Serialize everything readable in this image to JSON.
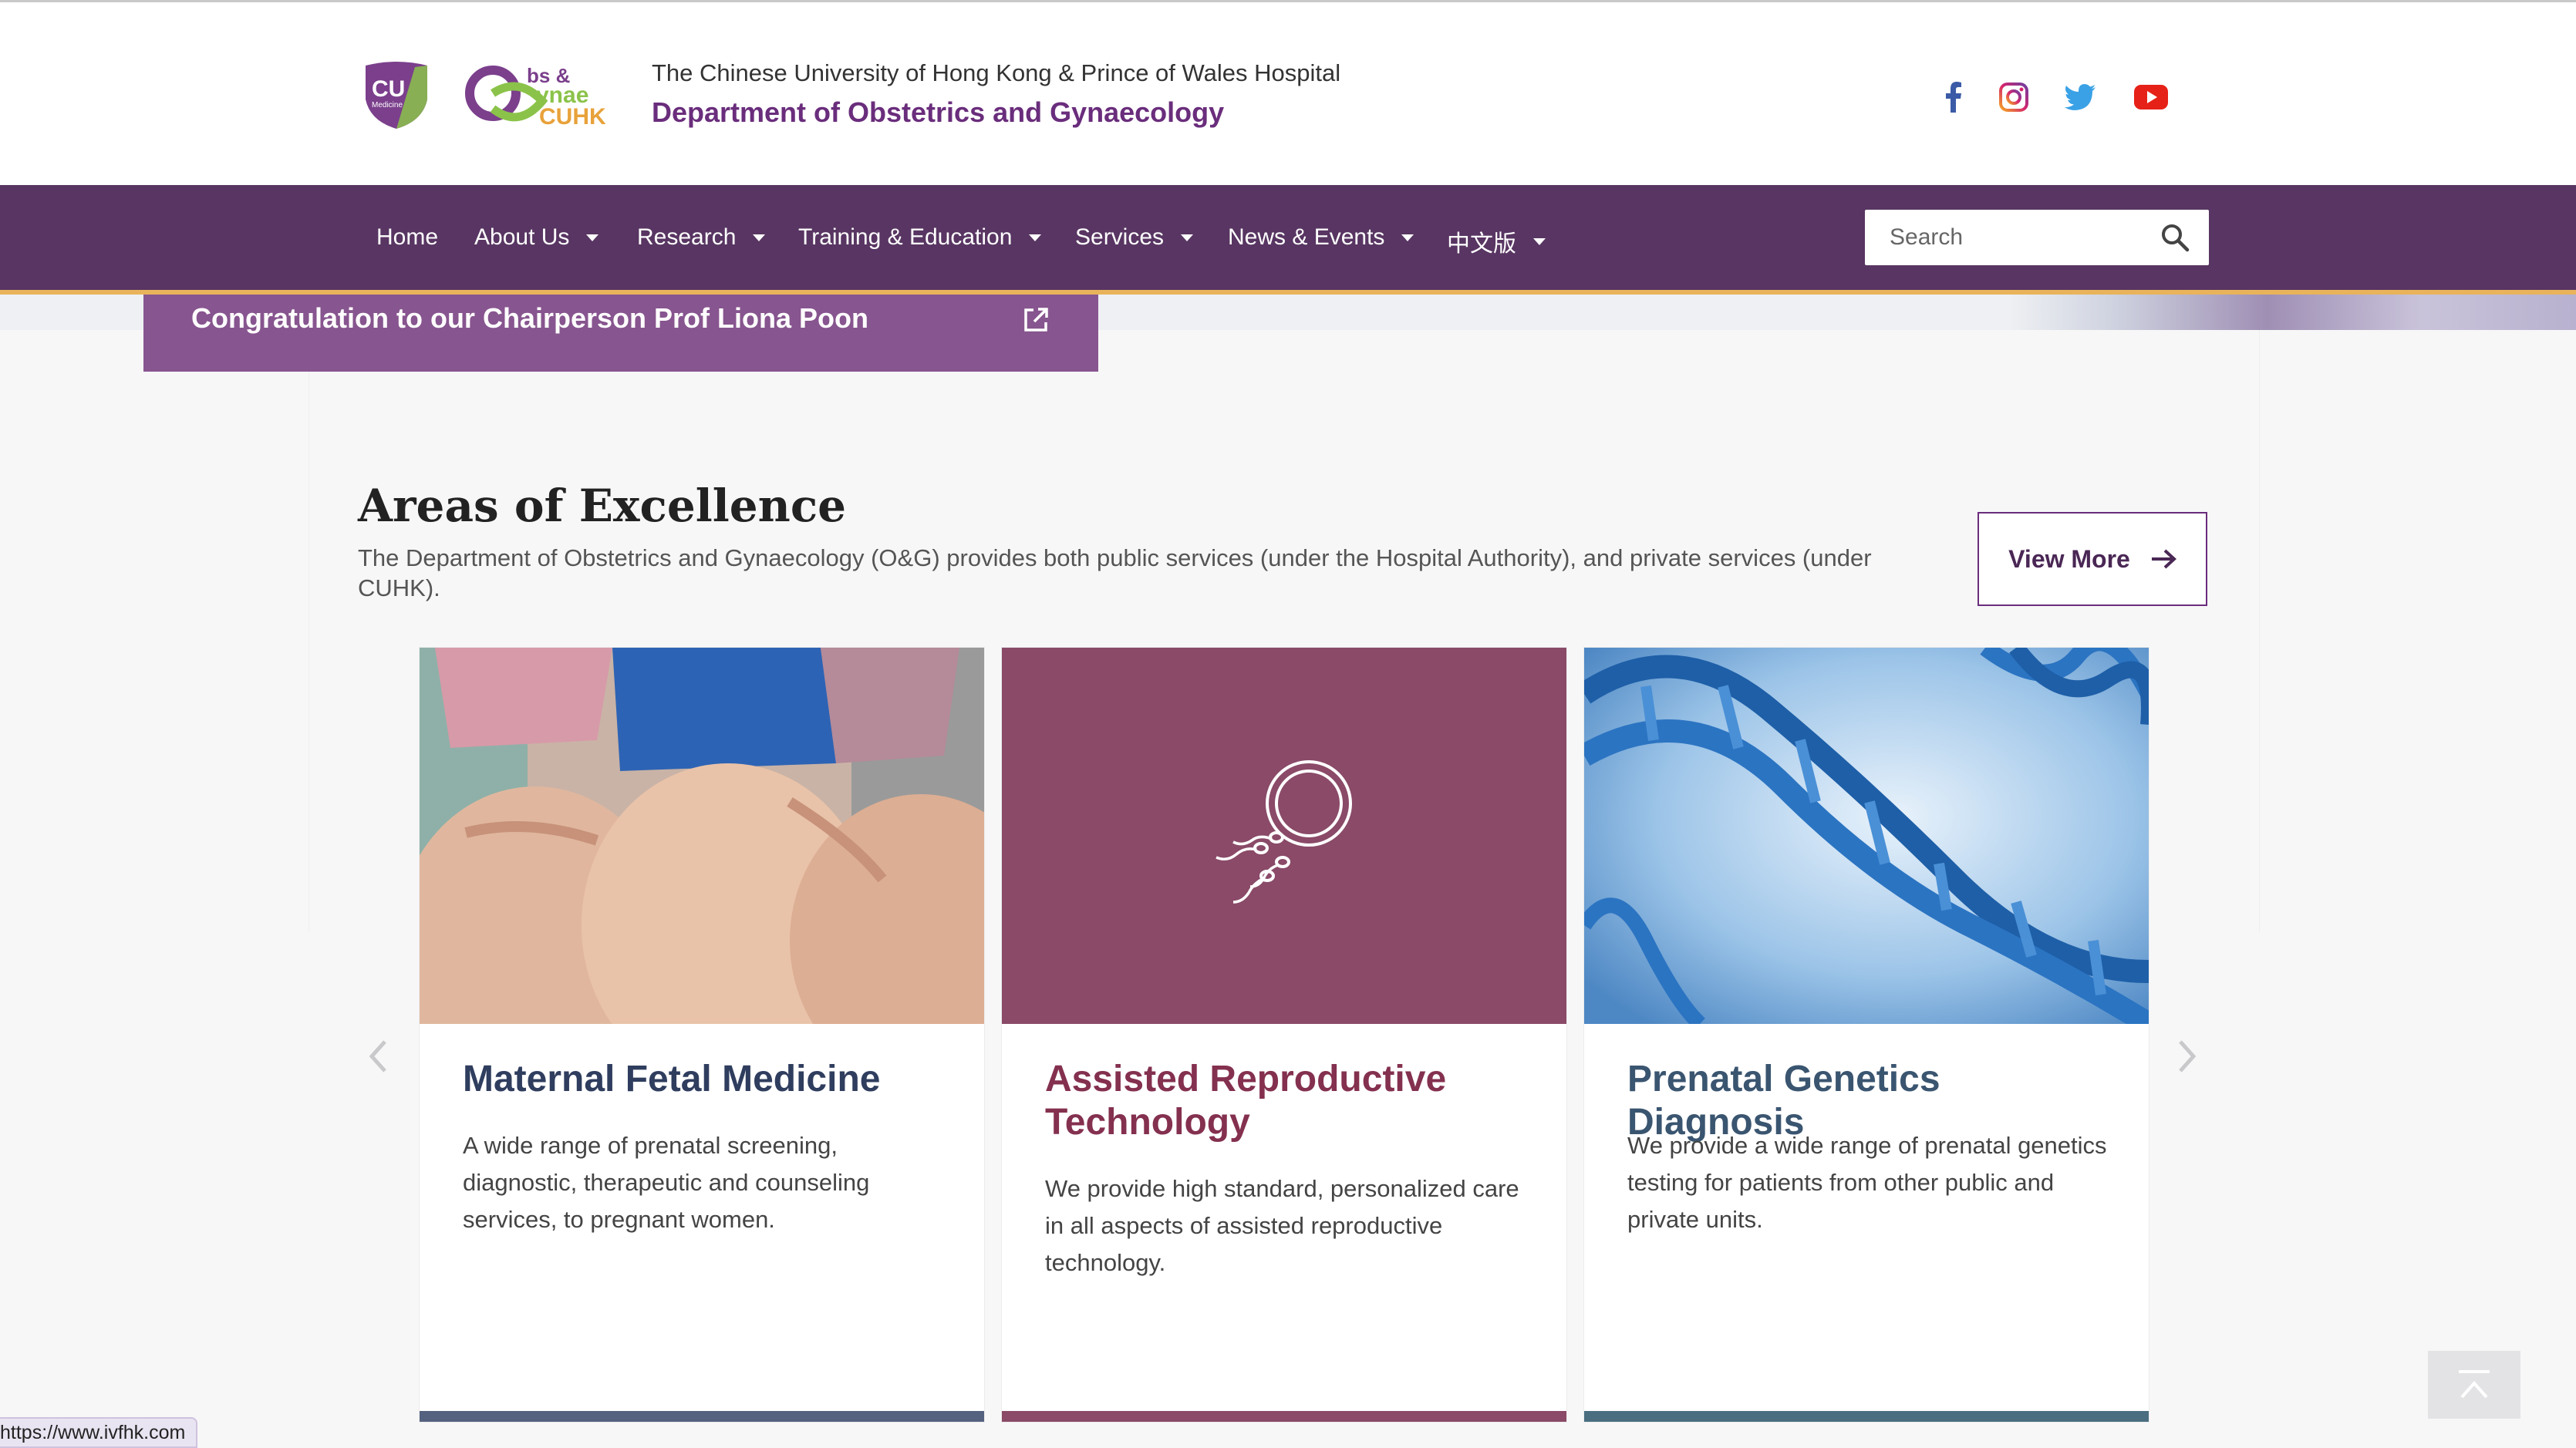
{
  "header": {
    "institution": "The Chinese University of Hong Kong & Prince of Wales Hospital",
    "department": "Department of Obstetrics and Gynaecology",
    "logo_cu_text": "CU",
    "logo_cu_sub": "Medicine",
    "logo_og_text_1": "bs &",
    "logo_og_text_2": "ynae",
    "logo_og_text_3": "CUHK",
    "social": [
      "facebook-icon",
      "instagram-icon",
      "twitter-icon",
      "youtube-icon"
    ]
  },
  "nav": {
    "items": [
      {
        "label": "Home",
        "dropdown": false
      },
      {
        "label": "About Us",
        "dropdown": true
      },
      {
        "label": "Research",
        "dropdown": true
      },
      {
        "label": "Training & Education",
        "dropdown": true
      },
      {
        "label": "Services",
        "dropdown": true
      },
      {
        "label": "News & Events",
        "dropdown": true
      },
      {
        "label": "中文版",
        "dropdown": true
      }
    ],
    "search_placeholder": "Search"
  },
  "announcement": {
    "text": "Congratulation to our Chairperson Prof Liona Poon"
  },
  "section": {
    "title": "Areas of Excellence",
    "description": "The Department of Obstetrics and Gynaecology (O&G) provides both public services (under the Hospital Authority), and private services (under CUHK).",
    "view_more": "View More"
  },
  "cards": [
    {
      "title": "Maternal Fetal Medicine",
      "description": "A wide range of prenatal screening, diagnostic, therapeutic and counseling services, to pregnant women.",
      "title_color": "#2f3d5e",
      "bar_color": "#54617f"
    },
    {
      "title": "Assisted Reproductive Technology",
      "description": "We provide high standard, personalized care in all aspects of assisted reproductive technology.",
      "title_color": "#84304f",
      "bar_color": "#8a4a68"
    },
    {
      "title": "Prenatal Genetics Diagnosis",
      "description": "We provide a wide range of prenatal genetics testing for patients from other public and private units.",
      "title_color": "#3a5570",
      "bar_color": "#4a6e80"
    }
  ],
  "status_bar": {
    "url": "https://www.ivfhk.com"
  },
  "colors": {
    "nav_bg": "#583562",
    "accent_purple": "#6a2d7c",
    "announcement_bg": "#87558f",
    "gold_line": "#e8b35a"
  }
}
